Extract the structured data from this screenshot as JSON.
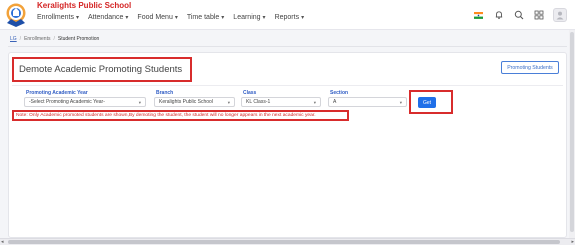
{
  "header": {
    "school_name": "Keralights Public School",
    "nav": [
      {
        "label": "Enrollments"
      },
      {
        "label": "Attendance"
      },
      {
        "label": "Food Menu"
      },
      {
        "label": "Time table"
      },
      {
        "label": "Learning"
      },
      {
        "label": "Reports"
      }
    ],
    "icons": [
      "flag-icon",
      "bell-icon",
      "search-icon",
      "grid-icon",
      "avatar-icon"
    ]
  },
  "breadcrumb": {
    "home": "LG",
    "sep1": "/",
    "section": "Enrollments",
    "sep2": "/",
    "current": "Student Promotion"
  },
  "page": {
    "title": "Demote Academic Promoting Students",
    "promoting_button": "Promoting Students"
  },
  "filters": {
    "year": {
      "label": "Promoting Academic Year",
      "value": "-Select Promoting Academic Year-"
    },
    "branch": {
      "label": "Branch",
      "value": "Keralights Public School"
    },
    "class": {
      "label": "Class",
      "value": "KL Class-1"
    },
    "section": {
      "label": "Section",
      "value": "A"
    },
    "get_button": "Get"
  },
  "note": "Note: Only Academic promoted students are shown,By demoting the student, the student will no longer appears in the next academic year.",
  "colors": {
    "accent": "#1f6fe8",
    "brand_red": "#d42424",
    "label_blue": "#2f5cc4",
    "highlight_border": "#d82c2c"
  }
}
